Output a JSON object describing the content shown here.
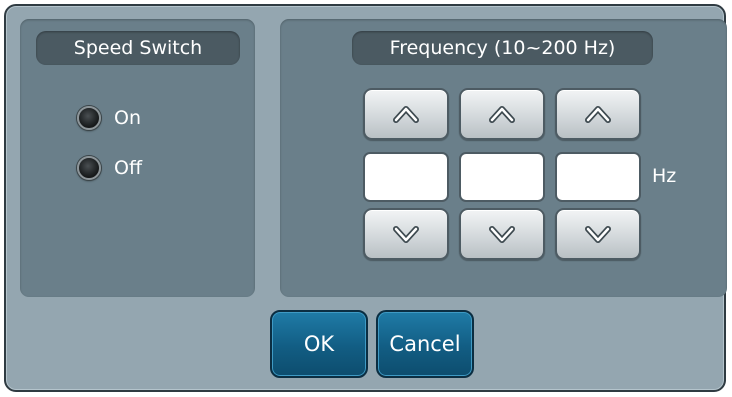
{
  "speed_switch": {
    "title": "Speed Switch",
    "options": [
      {
        "label": "On"
      },
      {
        "label": "Off"
      }
    ]
  },
  "frequency": {
    "title": "Frequency (10~200 Hz)",
    "digits": [
      "",
      "",
      ""
    ],
    "unit": "Hz",
    "up_icon": "chevron-up-icon",
    "down_icon": "chevron-down-icon"
  },
  "actions": {
    "ok_label": "OK",
    "cancel_label": "Cancel"
  },
  "colors": {
    "dialog_bg": "#94a6b0",
    "panel_bg": "#6a7f8a",
    "title_bg": "#4b5a62",
    "action_button": "#125d83"
  }
}
